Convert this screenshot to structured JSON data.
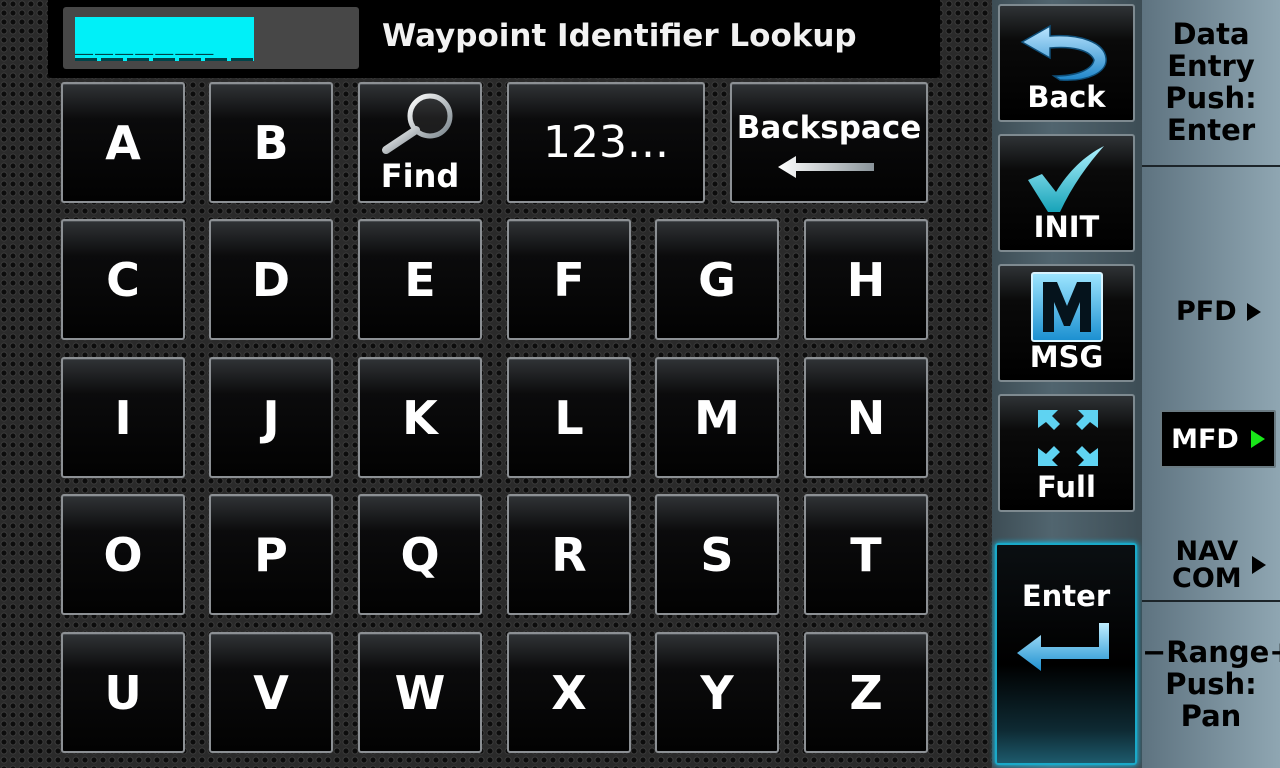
{
  "header": {
    "entry_value": "_______",
    "title": "Waypoint Identifier Lookup"
  },
  "keypad": {
    "find_label": "Find",
    "numeric_label": "123...",
    "backspace_label": "Backspace",
    "letters": [
      "A",
      "B",
      "C",
      "D",
      "E",
      "F",
      "G",
      "H",
      "I",
      "J",
      "K",
      "L",
      "M",
      "N",
      "O",
      "P",
      "Q",
      "R",
      "S",
      "T",
      "U",
      "V",
      "W",
      "X",
      "Y",
      "Z"
    ]
  },
  "side_buttons": {
    "back_label": "Back",
    "init_label": "INIT",
    "msg_label": "MSG",
    "full_label": "Full",
    "enter_label": "Enter"
  },
  "softkeys": {
    "data_entry_lines": [
      "Data",
      "Entry",
      "Push:",
      "Enter"
    ],
    "pfd_label": "PFD",
    "mfd_label": "MFD",
    "navcom_lines": [
      "NAV",
      "COM"
    ],
    "range_lines": [
      "−Range+",
      "Push:",
      "Pan"
    ]
  },
  "colors": {
    "entry_highlight": "#00f0f8",
    "accent_cyan": "#1aa9c8",
    "selected_indicator": "#19e619"
  },
  "icons": {
    "back": "back-arrow-icon",
    "init": "checkmark-icon",
    "msg": "message-m-icon",
    "full": "fullscreen-arrows-icon",
    "enter": "enter-return-arrow-icon",
    "find": "magnifier-icon",
    "backspace": "left-arrow-icon"
  }
}
